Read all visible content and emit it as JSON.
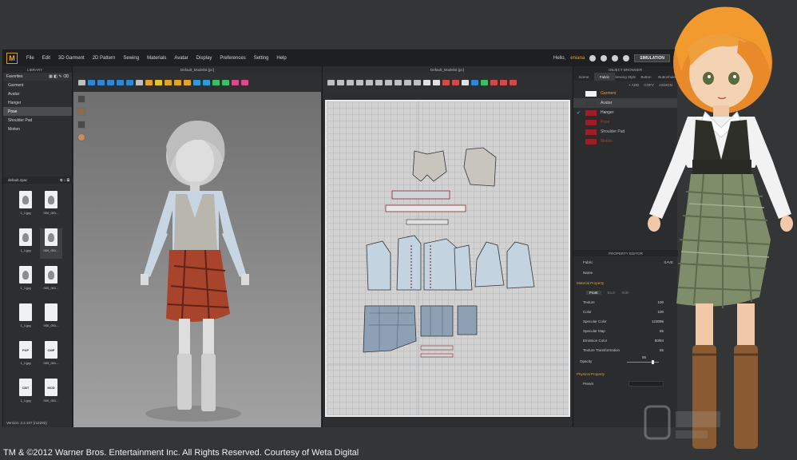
{
  "menubar": {
    "logo": "M",
    "items": [
      "File",
      "Edit",
      "3D Garment",
      "2D Pattern",
      "Sewing",
      "Materials",
      "Avatar",
      "Display",
      "Preferences",
      "Setting",
      "Help"
    ],
    "greeting": "Hello,",
    "username": "eniana",
    "simulation_label": "SIMULATION"
  },
  "library": {
    "title": "LIBRARY",
    "favorites_label": "Favorites",
    "items": [
      "Garment",
      "Avatar",
      "Hanger",
      "Pose",
      "Shoulder Pad",
      "Motion"
    ],
    "active_item": "Pose",
    "folder_label": "default.zpac",
    "thumbnails": [
      {
        "label": "1_1.jpg",
        "type": "face"
      },
      {
        "label": "000_001...",
        "type": "face"
      },
      {
        "label": "1_1.jpg",
        "type": "face"
      },
      {
        "label": "000_001...",
        "type": "face"
      },
      {
        "label": "1_1.jpg",
        "type": "face"
      },
      {
        "label": "000_001...",
        "type": "face"
      },
      {
        "label": "1_1.jpg",
        "type": "doc"
      },
      {
        "label": "000_001...",
        "type": "doc"
      },
      {
        "label": "1_1.jpg",
        "type": "text",
        "text": "PXP"
      },
      {
        "label": "000_001...",
        "type": "text",
        "text": "CMP"
      },
      {
        "label": "1_1.jpg",
        "type": "text",
        "text": "CMT"
      },
      {
        "label": "000_001...",
        "type": "text",
        "text": "MOD"
      }
    ],
    "version": "Version: 2.2.107 (r12292)"
  },
  "view3d": {
    "title": "Default_Modelist.[pc]"
  },
  "view2d": {
    "title": "Default_Modelist.[pc]"
  },
  "object_browser": {
    "title": "OBJECT BROWSER",
    "tabs": [
      "Scene",
      "Fabric",
      "Sewing Style",
      "Button",
      "Buttonhole"
    ],
    "active_tab": "Fabric",
    "actions": [
      "+ ADD",
      "COPY",
      "ASSIGN"
    ],
    "fabrics": [
      {
        "name": "Garment",
        "color": "#f2f2f2",
        "text_color": "#e2a02a",
        "selected": false,
        "checked": false
      },
      {
        "name": "Avatar",
        "color": "#3b3c3e",
        "text_color": "#d0d0d0",
        "selected": true,
        "checked": false
      },
      {
        "name": "Hanger",
        "color": "#9c1f26",
        "text_color": "#d0d0d0",
        "selected": false,
        "checked": true
      },
      {
        "name": "Pose",
        "color": "#9c1f26",
        "text_color": "#c0392b",
        "selected": false,
        "checked": false
      },
      {
        "name": "Shoulder Pad",
        "color": "#9c1f26",
        "text_color": "#b9b9b9",
        "selected": false,
        "checked": false
      },
      {
        "name": "Motion",
        "color": "#9c1f26",
        "text_color": "#c0392b",
        "selected": false,
        "checked": false
      }
    ]
  },
  "property_editor": {
    "title": "PROPERTY EDITOR",
    "save_label": "SAVE",
    "rows": {
      "fabric": "Fabric",
      "name": "Name",
      "material_property": "Material Property",
      "faces": [
        "Front",
        "Back",
        "Side"
      ],
      "texture": "Texture",
      "texture_val": "100",
      "color": "Color",
      "color_val": "100",
      "specular_color": "Specular Color",
      "specular_color_val": "123086",
      "specular_map": "Specular Map",
      "specular_map_val": "55",
      "emission_color": "Emission Color",
      "emission_color_val": "50/84",
      "texture_transformation": "Texture Transformation",
      "texture_transformation_val": "55",
      "opacity": "Opacity",
      "opacity_val": "55",
      "physical_property": "Physical Property",
      "preset": "Preset"
    }
  },
  "caption": "TM & ©2012 Warner Bros. Entertainment Inc. All Rights Reserved. Courtesy of Weta Digital",
  "colors": {
    "accent": "#e2a02a",
    "plaid_red": "#a8442b",
    "plaid_green": "#7f8d6a",
    "pattern_blue": "#c3d3e0"
  }
}
